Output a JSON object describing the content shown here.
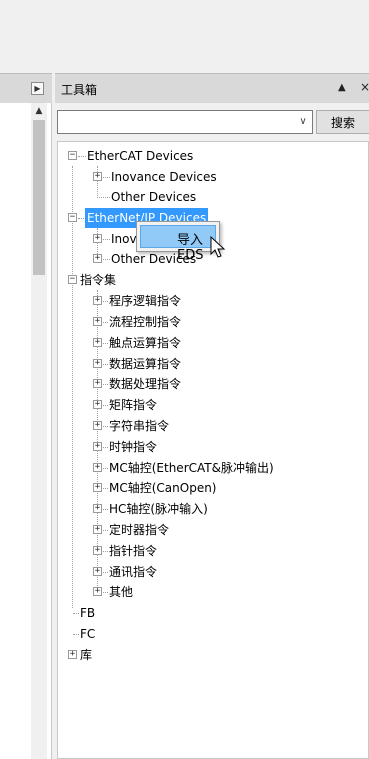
{
  "left_pane": {
    "arrow_icon": "triangle-right-icon",
    "scroll_up_icon": "triangle-up-icon"
  },
  "toolbox": {
    "title": "工具箱",
    "pin_icon": "pin-icon",
    "close_icon": "close-icon",
    "search": {
      "value": "",
      "dropdown_icon": "chevron-down-icon",
      "button_label": "搜索"
    }
  },
  "tree": {
    "ethercat": "EtherCAT Devices",
    "ethercat_inovance": "Inovance Devices",
    "ethercat_other": "Other Devices",
    "ethernetip": "EtherNet/IP Devices",
    "ethernetip_inovance": "Inovance Devices",
    "ethernetip_other": "Other Devices",
    "instructions": "指令集",
    "instruction_items": [
      "程序逻辑指令",
      "流程控制指令",
      "触点运算指令",
      "数据运算指令",
      "数据处理指令",
      "矩阵指令",
      "字符串指令",
      "时钟指令",
      "MC轴控(EtherCAT&脉冲输出)",
      "MC轴控(CanOpen)",
      "HC轴控(脉冲输入)",
      "定时器指令",
      "指针指令",
      "通讯指令",
      "其他"
    ],
    "fb": "FB",
    "fc": "FC",
    "library": "库"
  },
  "context_menu": {
    "import_eds": "导入EDS"
  },
  "colors": {
    "selection": "#3399ff",
    "menu_highlight": "#91c9f7"
  }
}
